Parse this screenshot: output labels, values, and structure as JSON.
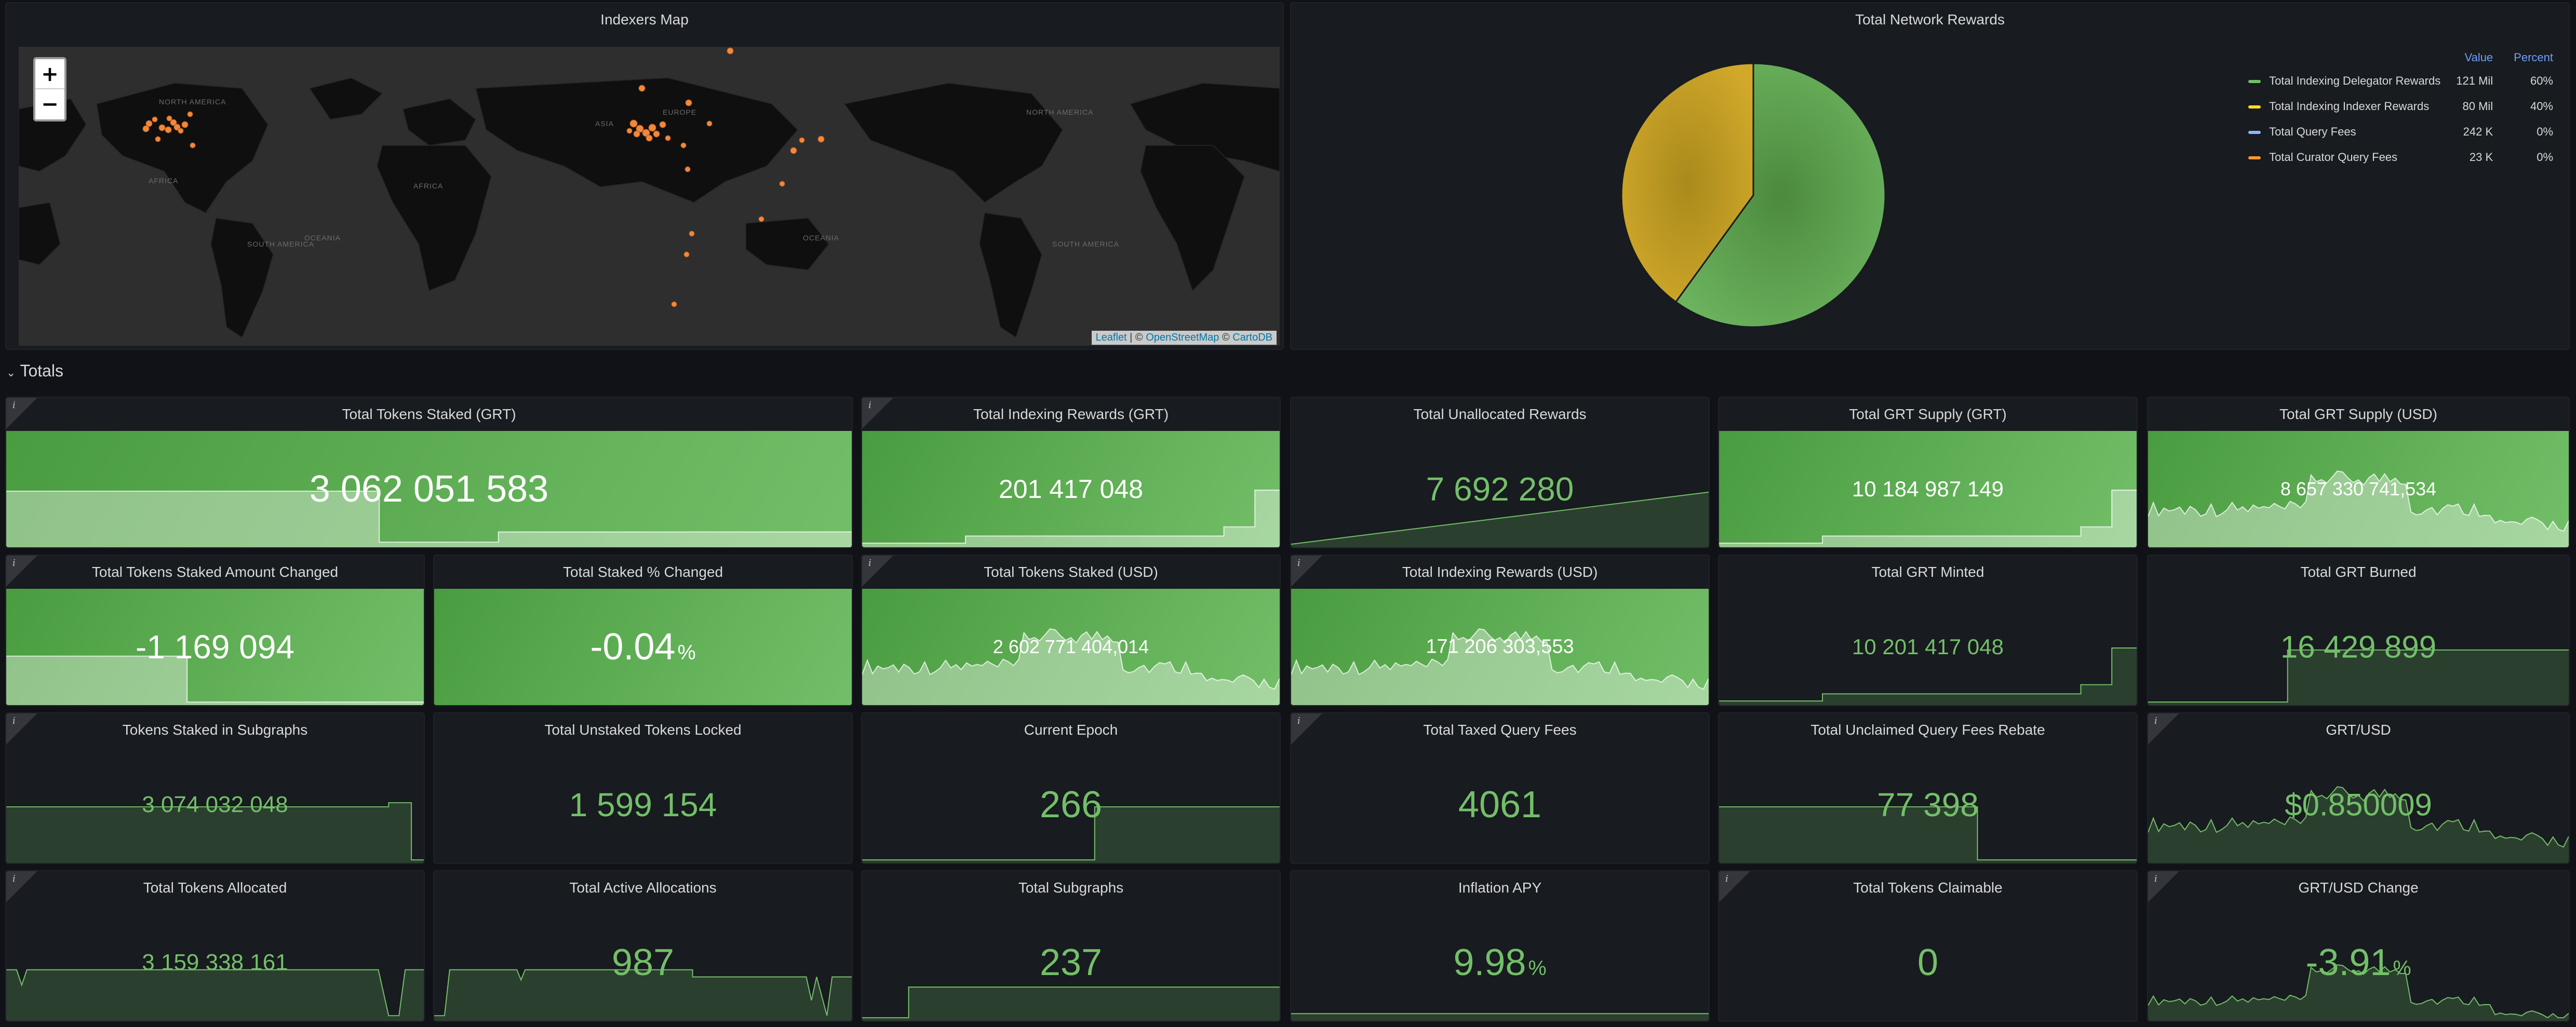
{
  "map_panel": {
    "title": "Indexers Map",
    "zoom_in": "+",
    "zoom_out": "−",
    "attribution": {
      "leaflet": "Leaflet",
      "sep": " | © ",
      "osm": "OpenStreetMap",
      "sep2": " © ",
      "carto": "CartoDB"
    },
    "region_labels": [
      "NORTH AMERICA",
      "SOUTH AMERICA",
      "AFRICA",
      "ASIA",
      "OCEANIA",
      "EUROPE",
      "NORTH AMERICA",
      "SOUTH AMERICA",
      "AFRICA",
      "OCEANIA"
    ],
    "marker_color": "#f2883a"
  },
  "pie_panel": {
    "title": "Total Network Rewards",
    "legend_headers": {
      "value": "Value",
      "percent": "Percent"
    },
    "chart_data": {
      "type": "pie",
      "series": [
        {
          "name": "Total Indexing Delegator Rewards",
          "value_label": "121 Mil",
          "percent_label": "60%",
          "percent": 60,
          "color": "#73bf69"
        },
        {
          "name": "Total Indexing Indexer Rewards",
          "value_label": "80 Mil",
          "percent_label": "40%",
          "percent": 40,
          "color": "#fade2a"
        },
        {
          "name": "Total Query Fees",
          "value_label": "242 K",
          "percent_label": "0%",
          "percent": 0,
          "color": "#8ab8ff"
        },
        {
          "name": "Total Curator Query Fees",
          "value_label": "23 K",
          "percent_label": "0%",
          "percent": 0,
          "color": "#ff9830"
        }
      ]
    }
  },
  "row": {
    "chevron": "⌄",
    "title": "Totals"
  },
  "info_glyph": "i",
  "stats": {
    "tokens_staked_grt": {
      "title": "Total Tokens Staked (GRT)",
      "value": "3 062 051 583"
    },
    "indexing_rewards_grt": {
      "title": "Total Indexing Rewards (GRT)",
      "value": "201 417 048"
    },
    "unallocated_rewards": {
      "title": "Total Unallocated Rewards",
      "value": "7 692 280"
    },
    "grt_supply_grt": {
      "title": "Total GRT Supply (GRT)",
      "value": "10 184 987 149"
    },
    "grt_supply_usd": {
      "title": "Total GRT Supply (USD)",
      "value": "8 657 330 741,534"
    },
    "staked_amount_changed": {
      "title": "Total Tokens Staked Amount Changed",
      "value": "-1 169 094"
    },
    "staked_pct_changed": {
      "title": "Total Staked % Changed",
      "value": "-0.04",
      "unit": "%"
    },
    "tokens_staked_usd": {
      "title": "Total Tokens Staked (USD)",
      "value": "2 602 771 404,014"
    },
    "indexing_rewards_usd": {
      "title": "Total Indexing Rewards (USD)",
      "value": "171 206 303,553"
    },
    "grt_minted": {
      "title": "Total GRT Minted",
      "value": "10 201 417 048"
    },
    "grt_burned": {
      "title": "Total GRT Burned",
      "value": "16 429 899"
    },
    "tokens_in_subgraphs": {
      "title": "Tokens Staked in Subgraphs",
      "value": "3 074 032 048"
    },
    "unstaked_locked": {
      "title": "Total Unstaked Tokens Locked",
      "value": "1 599 154"
    },
    "current_epoch": {
      "title": "Current Epoch",
      "value": "266"
    },
    "taxed_query_fees": {
      "title": "Total Taxed Query Fees",
      "value": "4061"
    },
    "unclaimed_rebate": {
      "title": "Total Unclaimed Query Fees Rebate",
      "value": "77 398"
    },
    "grt_usd": {
      "title": "GRT/USD",
      "value": "$0.850009"
    },
    "tokens_allocated": {
      "title": "Total Tokens Allocated",
      "value": "3 159 338 161"
    },
    "active_allocations": {
      "title": "Total Active Allocations",
      "value": "987"
    },
    "total_subgraphs": {
      "title": "Total Subgraphs",
      "value": "237"
    },
    "inflation_apy": {
      "title": "Inflation APY",
      "value": "9.98",
      "unit": "%"
    },
    "tokens_claimable": {
      "title": "Total Tokens Claimable",
      "value": "0"
    },
    "grt_usd_change": {
      "title": "GRT/USD Change",
      "value": "-3.91",
      "unit": "%"
    }
  }
}
